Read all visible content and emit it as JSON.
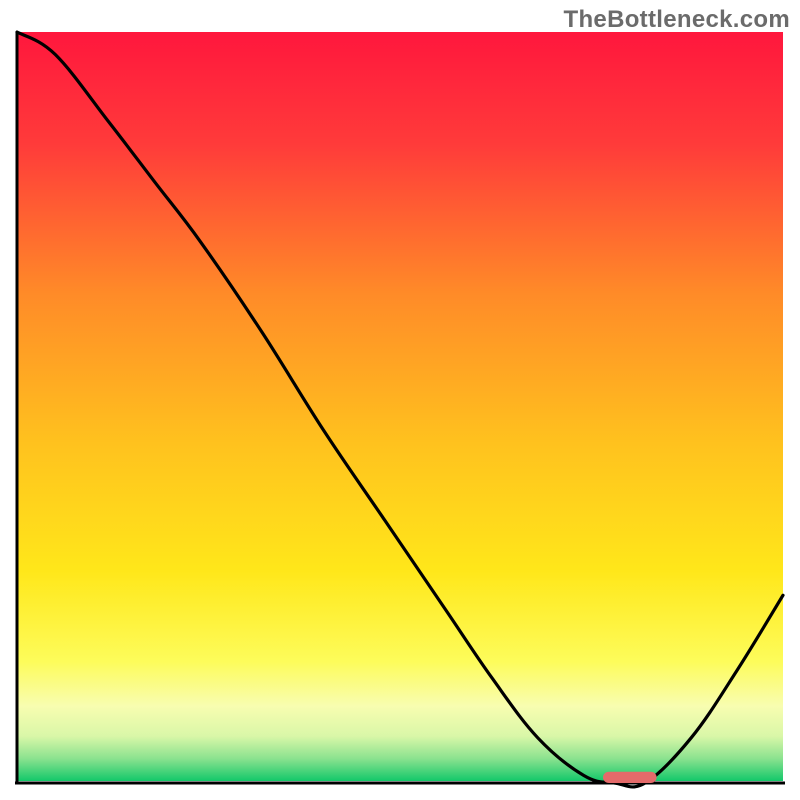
{
  "watermark": "TheBottleneck.com",
  "chart_data": {
    "type": "line",
    "title": "",
    "xlabel": "",
    "ylabel": "",
    "xlim": [
      0,
      100
    ],
    "ylim": [
      0,
      100
    ],
    "series": [
      {
        "name": "curve",
        "x": [
          0,
          5,
          12,
          18,
          24,
          32,
          40,
          48,
          56,
          62,
          68,
          74,
          78,
          82,
          88,
          94,
          100
        ],
        "values": [
          100,
          97,
          88,
          80,
          72,
          60,
          47,
          35,
          23,
          14,
          6,
          1,
          0,
          0,
          6,
          15,
          25
        ]
      }
    ],
    "marker": {
      "x_center": 80,
      "y": 0,
      "width": 7,
      "height": 1.5,
      "color": "#e46a6a"
    },
    "gradient_stops": [
      {
        "offset": 0.0,
        "color": "#ff173d"
      },
      {
        "offset": 0.15,
        "color": "#ff3b3a"
      },
      {
        "offset": 0.35,
        "color": "#ff8b28"
      },
      {
        "offset": 0.55,
        "color": "#ffc21e"
      },
      {
        "offset": 0.72,
        "color": "#ffe71a"
      },
      {
        "offset": 0.84,
        "color": "#fdfc5a"
      },
      {
        "offset": 0.9,
        "color": "#f8fdb0"
      },
      {
        "offset": 0.94,
        "color": "#d9f7a8"
      },
      {
        "offset": 0.97,
        "color": "#8be28f"
      },
      {
        "offset": 1.0,
        "color": "#13c86a"
      }
    ],
    "axes": {
      "color": "#000000",
      "width": 3
    }
  }
}
